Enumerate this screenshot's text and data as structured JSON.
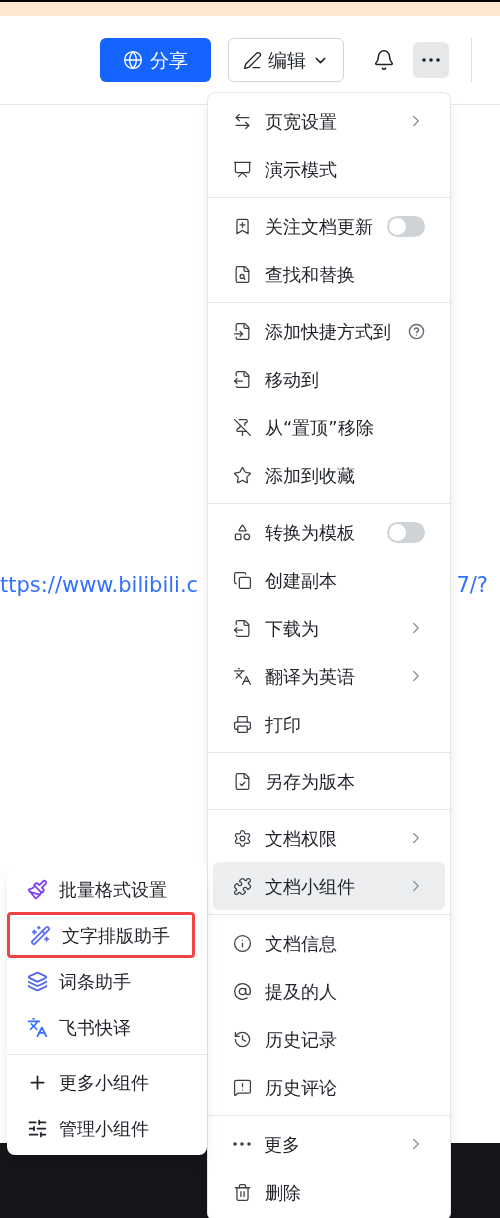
{
  "header": {
    "share_button": "分享",
    "edit_button": "编辑"
  },
  "document": {
    "link_left": "ttps://www.bilibili.c",
    "link_right": "7/?"
  },
  "menu": {
    "sections": [
      [
        {
          "label": "页宽设置",
          "kind": "submenu",
          "selected": false
        },
        {
          "label": "演示模式",
          "kind": "plain",
          "selected": false
        }
      ],
      [
        {
          "label": "关注文档更新",
          "kind": "toggle",
          "on": false,
          "selected": false
        },
        {
          "label": "查找和替换",
          "kind": "plain",
          "selected": false
        }
      ],
      [
        {
          "label": "添加快捷方式到",
          "kind": "help",
          "selected": false
        },
        {
          "label": "移动到",
          "kind": "plain",
          "selected": false
        },
        {
          "label": "从“置顶”移除",
          "kind": "plain",
          "selected": false
        },
        {
          "label": "添加到收藏",
          "kind": "plain",
          "selected": false
        }
      ],
      [
        {
          "label": "转换为模板",
          "kind": "toggle",
          "on": false,
          "selected": false
        },
        {
          "label": "创建副本",
          "kind": "plain",
          "selected": false
        },
        {
          "label": "下载为",
          "kind": "submenu",
          "selected": false
        },
        {
          "label": "翻译为英语",
          "kind": "submenu",
          "selected": false
        },
        {
          "label": "打印",
          "kind": "plain",
          "selected": false
        }
      ],
      [
        {
          "label": "另存为版本",
          "kind": "plain",
          "selected": false
        }
      ],
      [
        {
          "label": "文档权限",
          "kind": "submenu",
          "selected": false
        },
        {
          "label": "文档小组件",
          "kind": "submenu",
          "selected": true
        }
      ],
      [
        {
          "label": "文档信息",
          "kind": "plain",
          "selected": false
        },
        {
          "label": "提及的人",
          "kind": "plain",
          "selected": false
        },
        {
          "label": "历史记录",
          "kind": "plain",
          "selected": false
        },
        {
          "label": "历史评论",
          "kind": "plain",
          "selected": false
        }
      ],
      [
        {
          "label": "更多",
          "kind": "submenu",
          "selected": false
        },
        {
          "label": "删除",
          "kind": "plain",
          "selected": false
        }
      ]
    ]
  },
  "submenu": {
    "sections": [
      [
        {
          "label": "批量格式设置",
          "highlighted": false
        },
        {
          "label": "文字排版助手",
          "highlighted": true
        },
        {
          "label": "词条助手",
          "highlighted": false
        },
        {
          "label": "飞书快译",
          "highlighted": false
        }
      ],
      [
        {
          "label": "更多小组件",
          "highlighted": false
        },
        {
          "label": "管理小组件",
          "highlighted": false
        }
      ]
    ]
  }
}
